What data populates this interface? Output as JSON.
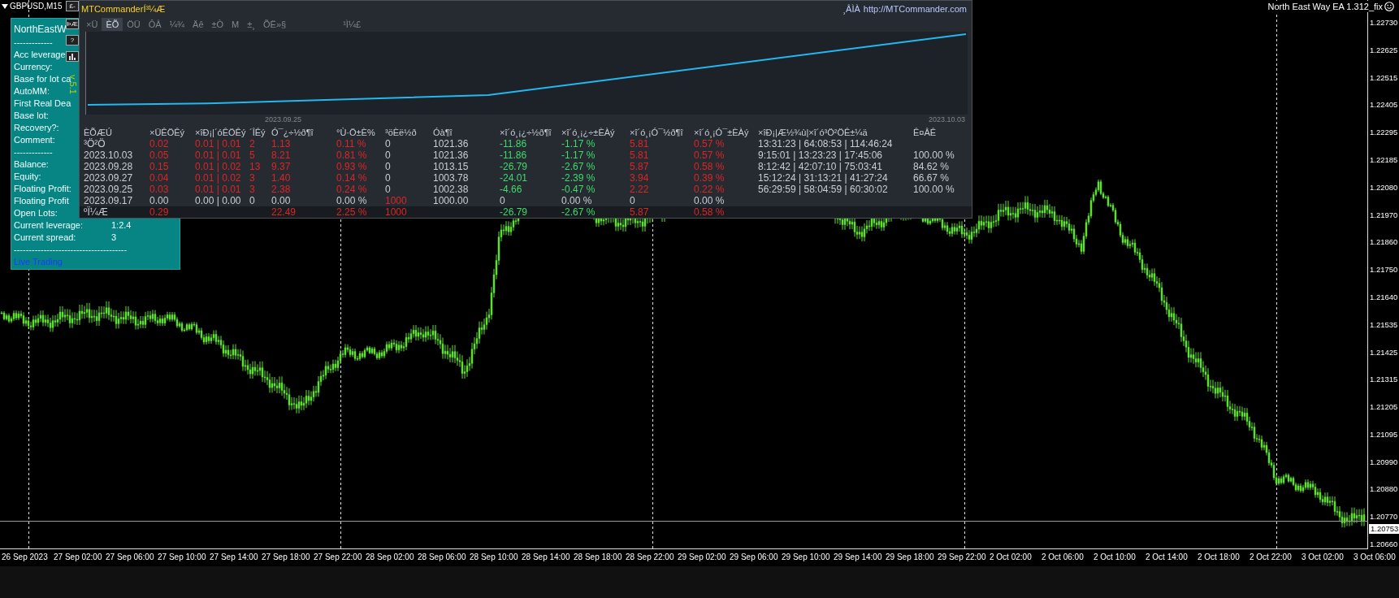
{
  "symbol_label": "GBPUSD,M15",
  "ea_label": "North East Way EA 1.312_fix",
  "side_buttons": [
    {
      "kind": "text",
      "label": "£-"
    },
    {
      "kind": "text",
      "label": "ÞÆ"
    },
    {
      "kind": "text",
      "label": "?"
    },
    {
      "kind": "chart"
    }
  ],
  "version_label": "v 5.1",
  "info_panel": {
    "title": "NorthEastW",
    "lines": [
      {
        "kind": "rule",
        "text": "-------------"
      },
      {
        "kind": "field",
        "label": "Acc leverage"
      },
      {
        "kind": "field",
        "label": "Currency:"
      },
      {
        "kind": "field",
        "label": "Base for lot ca"
      },
      {
        "kind": "field",
        "label": "AutoMM:"
      },
      {
        "kind": "field",
        "label": "First Real Dea"
      },
      {
        "kind": "field",
        "label": "Base lot:"
      },
      {
        "kind": "field",
        "label": "Recovery?:"
      },
      {
        "kind": "field",
        "label": "Comment:"
      },
      {
        "kind": "rule",
        "text": "-------------"
      },
      {
        "kind": "field",
        "label": "Balance:"
      },
      {
        "kind": "field",
        "label": "Equity:"
      },
      {
        "kind": "field",
        "label": "Floating Profit:"
      },
      {
        "kind": "field",
        "label": "Floating Profit"
      },
      {
        "kind": "field",
        "label": "Open Lots:"
      },
      {
        "kind": "field",
        "label": "Current leverage:",
        "value": "1:2.4"
      },
      {
        "kind": "field",
        "label": "Current spread:",
        "value": "3"
      },
      {
        "kind": "rule",
        "text": "--------------------------------------"
      },
      {
        "kind": "link",
        "text": "Live Trading"
      }
    ]
  },
  "commander": {
    "title": "MTCommanderÍ³¼Æ",
    "site_prefix": "¸ÂÌÀ",
    "site_link": "http://MTCommander.com",
    "tabs": [
      {
        "label": "×Ü",
        "selected": false
      },
      {
        "label": "ÈÕ",
        "selected": true
      },
      {
        "label": "ÖÜ",
        "selected": false
      },
      {
        "label": "ÔÂ",
        "selected": false
      },
      {
        "label": "¼¾",
        "selected": false
      },
      {
        "label": "Äê",
        "selected": false
      },
      {
        "label": "±Ò",
        "selected": false
      },
      {
        "label": "M",
        "selected": false
      },
      {
        "label": "±¸",
        "selected": false
      },
      {
        "label": "ÕË»§",
        "selected": false
      },
      {
        "label": "¹Ì¼£",
        "selected": false
      }
    ],
    "equity_chart": {
      "dates": [
        "2023.09.25",
        "2023.10.03"
      ]
    },
    "table": {
      "columns": [
        "ÈÕÆÚ",
        "×ÜÊÖÊý",
        "×îÐ¡|´óÊÖÊý",
        "´ÎÊý",
        "Ó¯¿÷½ð¶î",
        "°Ù·Ö±È%",
        "³öÈë½ð",
        "Óà¶î",
        "×î´ó¸¡¿÷½ð¶î",
        "×î´ó¸¡¿÷±ÈÀý",
        "×î´ó¸¡Ó¯½ð¶î",
        "×î´ó¸¡Ó¯±ÈÀý",
        "×îÐ¡|Æ½¾ù|×î´ó³Ö²ÖÊ±¼ä",
        "Ê¤ÂÊ"
      ],
      "rows": [
        {
          "cells": [
            {
              "text": "³Ö²Ö",
              "color": "#c9ced6"
            },
            {
              "text": "0.02",
              "color": "#e02424"
            },
            {
              "text": "0.01 | 0.01",
              "color": "#e02424"
            },
            {
              "text": "2",
              "color": "#e02424"
            },
            {
              "text": "1.13",
              "color": "#e02424"
            },
            {
              "text": "0.11 %",
              "color": "#e02424"
            },
            {
              "text": "0",
              "color": "#c9ced6"
            },
            {
              "text": "1021.36",
              "color": "#c9ced6"
            },
            {
              "text": "-11.86",
              "color": "#3ddc6a"
            },
            {
              "text": "-1.17 %",
              "color": "#3ddc6a"
            },
            {
              "text": "5.81",
              "color": "#e02424"
            },
            {
              "text": "0.57 %",
              "color": "#e02424"
            },
            {
              "text": "13:31:23 | 64:08:53 | 114:46:24",
              "color": "#c9ced6"
            },
            null
          ]
        },
        {
          "cells": [
            {
              "text": "2023.10.03",
              "color": "#c9ced6"
            },
            {
              "text": "0.05",
              "color": "#e02424"
            },
            {
              "text": "0.01 | 0.01",
              "color": "#e02424"
            },
            {
              "text": "5",
              "color": "#e02424"
            },
            {
              "text": "8.21",
              "color": "#e02424"
            },
            {
              "text": "0.81 %",
              "color": "#e02424"
            },
            {
              "text": "0",
              "color": "#c9ced6"
            },
            {
              "text": "1021.36",
              "color": "#c9ced6"
            },
            {
              "text": "-11.86",
              "color": "#3ddc6a"
            },
            {
              "text": "-1.17 %",
              "color": "#3ddc6a"
            },
            {
              "text": "5.81",
              "color": "#e02424"
            },
            {
              "text": "0.57 %",
              "color": "#e02424"
            },
            {
              "text": "9:15:01 | 13:23:23 | 17:45:06",
              "color": "#c9ced6"
            },
            {
              "text": "100.00 %",
              "color": "#c9ced6"
            }
          ]
        },
        {
          "cells": [
            {
              "text": "2023.09.28",
              "color": "#c9ced6"
            },
            {
              "text": "0.15",
              "color": "#e02424"
            },
            {
              "text": "0.01 | 0.02",
              "color": "#e02424"
            },
            {
              "text": "13",
              "color": "#e02424"
            },
            {
              "text": "9.37",
              "color": "#e02424"
            },
            {
              "text": "0.93 %",
              "color": "#e02424"
            },
            {
              "text": "0",
              "color": "#c9ced6"
            },
            {
              "text": "1013.15",
              "color": "#c9ced6"
            },
            {
              "text": "-26.79",
              "color": "#3ddc6a"
            },
            {
              "text": "-2.67 %",
              "color": "#3ddc6a"
            },
            {
              "text": "5.87",
              "color": "#e02424"
            },
            {
              "text": "0.58 %",
              "color": "#e02424"
            },
            {
              "text": "8:12:42 | 42:07:10 | 75:03:41",
              "color": "#c9ced6"
            },
            {
              "text": "84.62 %",
              "color": "#c9ced6"
            }
          ]
        },
        {
          "cells": [
            {
              "text": "2023.09.27",
              "color": "#c9ced6"
            },
            {
              "text": "0.04",
              "color": "#e02424"
            },
            {
              "text": "0.01 | 0.02",
              "color": "#e02424"
            },
            {
              "text": "3",
              "color": "#e02424"
            },
            {
              "text": "1.40",
              "color": "#e02424"
            },
            {
              "text": "0.14 %",
              "color": "#e02424"
            },
            {
              "text": "0",
              "color": "#c9ced6"
            },
            {
              "text": "1003.78",
              "color": "#c9ced6"
            },
            {
              "text": "-24.01",
              "color": "#3ddc6a"
            },
            {
              "text": "-2.39 %",
              "color": "#3ddc6a"
            },
            {
              "text": "3.94",
              "color": "#e02424"
            },
            {
              "text": "0.39 %",
              "color": "#e02424"
            },
            {
              "text": "15:12:24 | 31:13:21 | 41:27:24",
              "color": "#c9ced6"
            },
            {
              "text": "66.67 %",
              "color": "#c9ced6"
            }
          ]
        },
        {
          "cells": [
            {
              "text": "2023.09.25",
              "color": "#c9ced6"
            },
            {
              "text": "0.03",
              "color": "#e02424"
            },
            {
              "text": "0.01 | 0.01",
              "color": "#e02424"
            },
            {
              "text": "3",
              "color": "#e02424"
            },
            {
              "text": "2.38",
              "color": "#e02424"
            },
            {
              "text": "0.24 %",
              "color": "#e02424"
            },
            {
              "text": "0",
              "color": "#c9ced6"
            },
            {
              "text": "1002.38",
              "color": "#c9ced6"
            },
            {
              "text": "-4.66",
              "color": "#3ddc6a"
            },
            {
              "text": "-0.47 %",
              "color": "#3ddc6a"
            },
            {
              "text": "2.22",
              "color": "#e02424"
            },
            {
              "text": "0.22 %",
              "color": "#e02424"
            },
            {
              "text": "56:29:59 | 58:04:59 | 60:30:02",
              "color": "#c9ced6"
            },
            {
              "text": "100.00 %",
              "color": "#c9ced6"
            }
          ]
        },
        {
          "cells": [
            {
              "text": "2023.09.17",
              "color": "#c9ced6"
            },
            {
              "text": "0.00",
              "color": "#c9ced6"
            },
            {
              "text": "0.00 | 0.00",
              "color": "#c9ced6"
            },
            {
              "text": "0",
              "color": "#c9ced6"
            },
            {
              "text": "0.00",
              "color": "#c9ced6"
            },
            {
              "text": "0.00 %",
              "color": "#c9ced6"
            },
            {
              "text": "1000",
              "color": "#e02424"
            },
            {
              "text": "1000.00",
              "color": "#c9ced6"
            },
            {
              "text": "0",
              "color": "#c9ced6"
            },
            {
              "text": "0.00 %",
              "color": "#c9ced6"
            },
            {
              "text": "0",
              "color": "#c9ced6"
            },
            {
              "text": "0.00 %",
              "color": "#c9ced6"
            },
            null,
            null
          ]
        }
      ],
      "total": {
        "cells": [
          {
            "text": "ºÏ¼Æ",
            "color": "#c9ced6"
          },
          {
            "text": "0.29",
            "color": "#e02424"
          },
          null,
          null,
          {
            "text": "22.49",
            "color": "#e02424"
          },
          {
            "text": "2.25 %",
            "color": "#e02424"
          },
          {
            "text": "1000",
            "color": "#e02424"
          },
          null,
          {
            "text": "-26.79",
            "color": "#3ddc6a"
          },
          {
            "text": "-2.67 %",
            "color": "#3ddc6a"
          },
          {
            "text": "5.87",
            "color": "#e02424"
          },
          {
            "text": "0.58 %",
            "color": "#e02424"
          },
          null,
          null
        ]
      }
    }
  },
  "price_axis": {
    "labels": [
      "1.22730",
      "1.22625",
      "1.22515",
      "1.22405",
      "1.22295",
      "1.22185",
      "1.22080",
      "1.21970",
      "1.21860",
      "1.21750",
      "1.21640",
      "1.21535",
      "1.21425",
      "1.21315",
      "1.21205",
      "1.21095",
      "1.20990",
      "1.20880",
      "1.20770",
      "1.20660"
    ],
    "current": "1.20753"
  },
  "time_axis": {
    "labels": [
      "26 Sep 2023",
      "27 Sep 02:00",
      "27 Sep 06:00",
      "27 Sep 10:00",
      "27 Sep 14:00",
      "27 Sep 18:00",
      "27 Sep 22:00",
      "28 Sep 02:00",
      "28 Sep 06:00",
      "28 Sep 10:00",
      "28 Sep 14:00",
      "28 Sep 18:00",
      "28 Sep 22:00",
      "29 Sep 02:00",
      "29 Sep 06:00",
      "29 Sep 10:00",
      "29 Sep 14:00",
      "29 Sep 18:00",
      "29 Sep 22:00",
      "2 Oct 02:00",
      "2 Oct 06:00",
      "2 Oct 10:00",
      "2 Oct 14:00",
      "2 Oct 18:00",
      "2 Oct 22:00",
      "3 Oct 02:00",
      "3 Oct 06:00"
    ]
  }
}
